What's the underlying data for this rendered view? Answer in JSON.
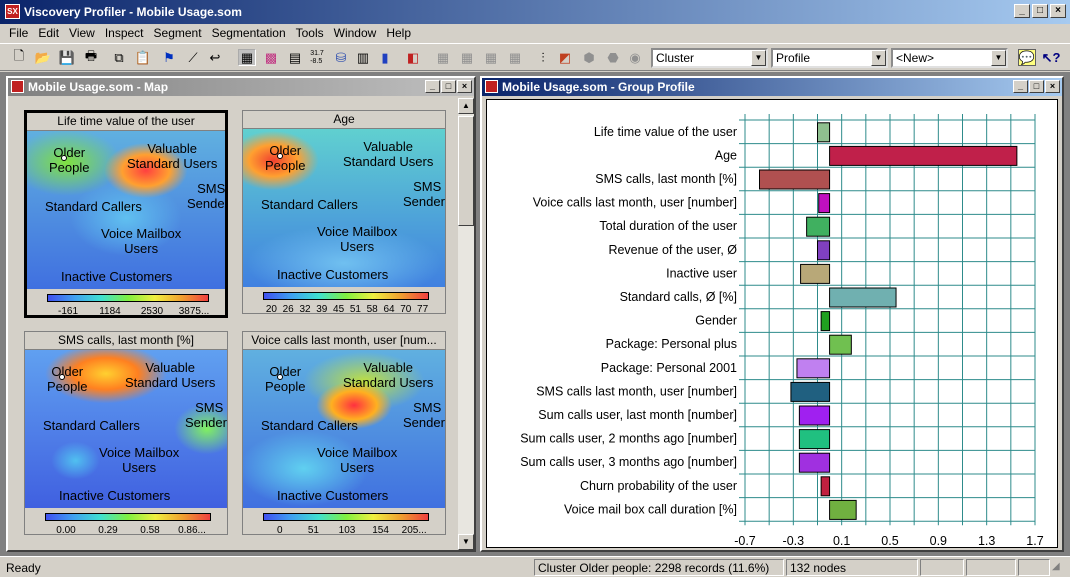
{
  "app": {
    "title": "Viscovery Profiler - Mobile Usage.som",
    "icon": "app-logo-icon"
  },
  "menu": [
    "File",
    "Edit",
    "View",
    "Inspect",
    "Segment",
    "Segmentation",
    "Tools",
    "Window",
    "Help"
  ],
  "toolbar": {
    "combo_cluster": "Cluster",
    "combo_profile": "Profile",
    "combo_new": "<New>"
  },
  "map_window": {
    "title": "Mobile Usage.som - Map",
    "region_labels": {
      "older": "Older\nPeople",
      "valuable": "Valuable\nStandard Users",
      "sms": "SMS\nSenders",
      "standard": "Standard Callers",
      "voice": "Voice Mailbox\nUsers",
      "inactive": "Inactive Customers"
    },
    "cards": [
      {
        "title": "Life time value of the user",
        "ticks": [
          "-161",
          "1184",
          "2530",
          "3875..."
        ],
        "selected": true
      },
      {
        "title": "Age",
        "ticks": [
          "20",
          "26",
          "32",
          "39",
          "45",
          "51",
          "58",
          "64",
          "70",
          "77"
        ],
        "selected": false
      },
      {
        "title": "SMS calls, last month [%]",
        "ticks": [
          "0.00",
          "0.29",
          "0.58",
          "0.86..."
        ],
        "selected": false
      },
      {
        "title": "Voice calls last month, user [num...",
        "ticks": [
          "0",
          "51",
          "103",
          "154",
          "205..."
        ],
        "selected": false
      }
    ]
  },
  "profile_window": {
    "title": "Mobile Usage.som - Group Profile"
  },
  "chart_data": {
    "type": "bar",
    "orientation": "horizontal",
    "categories": [
      "Life time value of the user",
      "Age",
      "SMS calls, last month [%]",
      "Voice calls last month, user [number]",
      "Total duration of the user",
      "Revenue of the user, Ø",
      "Inactive user",
      "Standard calls, Ø [%]",
      "Gender",
      "Package: Personal plus",
      "Package: Personal 2001",
      "SMS calls last month, user [number]",
      "Sum calls user, last month [number]",
      "Sum calls user, 2 months ago [number]",
      "Sum calls user, 3 months ago [number]",
      "Churn probability of the user",
      "Voice mail box call duration [%]"
    ],
    "values": [
      -0.1,
      1.55,
      -0.58,
      -0.09,
      -0.19,
      -0.1,
      -0.24,
      0.55,
      -0.07,
      0.18,
      -0.27,
      -0.32,
      -0.25,
      -0.25,
      -0.25,
      -0.07,
      0.22
    ],
    "colors": [
      "#8fc08f",
      "#c0204a",
      "#b05050",
      "#c010c0",
      "#40b060",
      "#8040c0",
      "#b8a878",
      "#70b0b0",
      "#20a020",
      "#70c050",
      "#c080f0",
      "#206080",
      "#a020f0",
      "#20c080",
      "#a030e0",
      "#c02040",
      "#70b040"
    ],
    "xlim": [
      -0.7,
      1.7
    ],
    "xticks": [
      "-0.7",
      "-0.3",
      "0.1",
      "0.5",
      "0.9",
      "1.3",
      "1.7"
    ],
    "grid": true
  },
  "status": {
    "ready": "Ready",
    "cluster": "Cluster Older people: 2298 records (11.6%)",
    "nodes": "132 nodes"
  }
}
